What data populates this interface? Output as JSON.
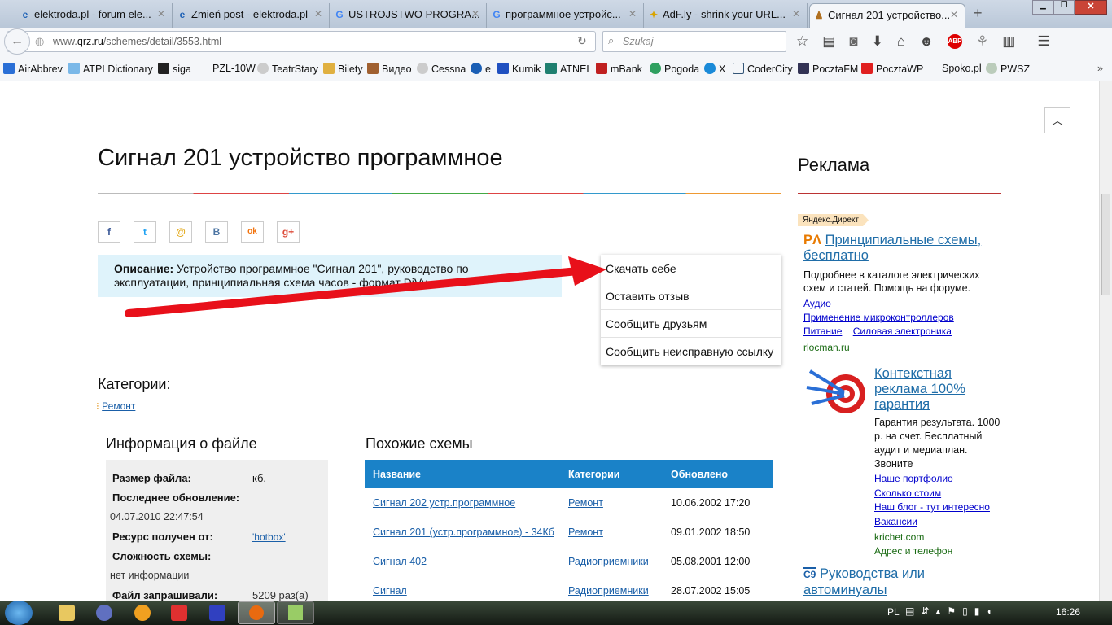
{
  "browser": {
    "tabs": [
      {
        "title": "elektroda.pl - forum ele...",
        "icon": "ie-icon"
      },
      {
        "title": "Zmień post - elektroda.pl",
        "icon": "ie-icon"
      },
      {
        "title": "USTROJSTWO PROGRA...",
        "icon": "google-icon"
      },
      {
        "title": "программное устройс...",
        "icon": "google-icon"
      },
      {
        "title": "AdF.ly - shrink your URL...",
        "icon": "adfly-icon"
      },
      {
        "title": "Сигнал 201 устройство...",
        "icon": "qrz-icon",
        "active": true
      }
    ],
    "url_host_prefix": "www.",
    "url_host": "qrz.ru",
    "url_path": "/schemes/detail/3553.html",
    "search_placeholder": "Szukaj",
    "bookmarks": [
      "AirAbbrev",
      "ATPLDictionary",
      "siga",
      "PZL-10W",
      "TeatrStary",
      "Bilety",
      "Видео",
      "Cessna",
      "e",
      "Kurnik",
      "ATNEL",
      "mBank",
      "Pogoda",
      "X",
      "CoderCity",
      "PocztaFM",
      "PocztaWP",
      "Spoko.pl",
      "PWSZ"
    ],
    "abp_label": "ABP"
  },
  "page": {
    "title": "Сигнал 201 устройство программное",
    "share_icons": [
      "f",
      "t",
      "@",
      "B",
      "ok",
      "g+"
    ],
    "description_label": "Описание:",
    "description_line1": "Устройство программное \"Сигнал 201\", руководство по",
    "description_line2": "эксплуатации, принципиальная схема часов - формат DjVu",
    "actions": [
      "Скачать себе",
      "Оставить отзыв",
      "Сообщить друзьям",
      "Сообщить неисправную ссылку"
    ],
    "categories_heading": "Категории:",
    "category": "Ремонт",
    "file_info": {
      "heading": "Информация о файле",
      "size_label": "Размер файла:",
      "size_value": "кб.",
      "updated_label": "Последнее обновление:",
      "updated_value": "04.07.2010 22:47:54",
      "source_label": "Ресурс получен от:",
      "source_value": "'hotbox'",
      "complexity_label": "Сложность схемы:",
      "complexity_value": "нет информации",
      "requests_label": "Файл запрашивали:",
      "requests_value": "5209 раз(а)"
    },
    "similar": {
      "heading": "Похожие схемы",
      "columns": [
        "Название",
        "Категории",
        "Обновлено"
      ],
      "rows": [
        [
          "Сигнал 202 устр.программное",
          "Ремонт",
          "10.06.2002 17:20"
        ],
        [
          "Сигнал 201 (устр.программное) - 34Кб",
          "Ремонт",
          "09.01.2002 18:50"
        ],
        [
          "Сигнал 402",
          "Радиоприемники",
          "05.08.2001 12:00"
        ],
        [
          "Сигнал",
          "Радиоприемники",
          "28.07.2002 15:05"
        ]
      ]
    }
  },
  "ads": {
    "heading": "Реклама",
    "badge": "Яндекс.Директ",
    "ad1": {
      "logo": "РΛ",
      "title": "Принципиальные схемы, бесплатно",
      "text": "Подробнее в каталоге электрических схем и статей. Помощь на форуме.",
      "links": [
        "Аудио",
        "Применение микроконтроллеров",
        "Питание",
        "Силовая электроника"
      ],
      "domain": "rlocman.ru"
    },
    "ad2": {
      "title": "Контекстная реклама 100% гарантия",
      "text": "Гарантия результата. 1000 р. на счет. Бесплатный аудит и медиаплан. Звоните",
      "links": [
        "Наше портфолио",
        "Сколько стоим",
        "Наш блог - тут интересно",
        "Вакансии"
      ],
      "domain": "krichet.com",
      "contact": "Адрес и телефон"
    },
    "ad3": {
      "logo": "C9",
      "title": "Руководства или автоминуалы"
    }
  },
  "taskbar": {
    "lang": "PL",
    "time": "16:26"
  },
  "colors": {
    "link": "#1a5fa8",
    "table_header": "#1a82c8",
    "desc_bg": "#dff3fb",
    "arrow": "#e8101a"
  }
}
